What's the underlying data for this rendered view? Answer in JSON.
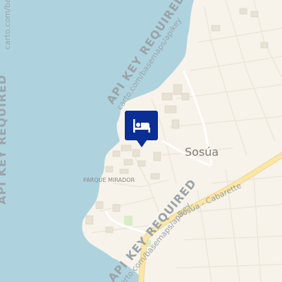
{
  "map": {
    "town_label": "Sosúa",
    "park_label": "PARQUE MIRADOR",
    "road_label": "Sosúa - Cabarette",
    "watermark": {
      "title": "API KEY REQUIRED",
      "subtitle": "carto.com/basemaps/apikey"
    },
    "marker": {
      "type": "hotel",
      "icon": "bed-icon",
      "color": "#0b2d96"
    },
    "colors": {
      "water": "#aed3df",
      "land": "#f7f3ea",
      "major_road": "#fbe6a6"
    }
  }
}
